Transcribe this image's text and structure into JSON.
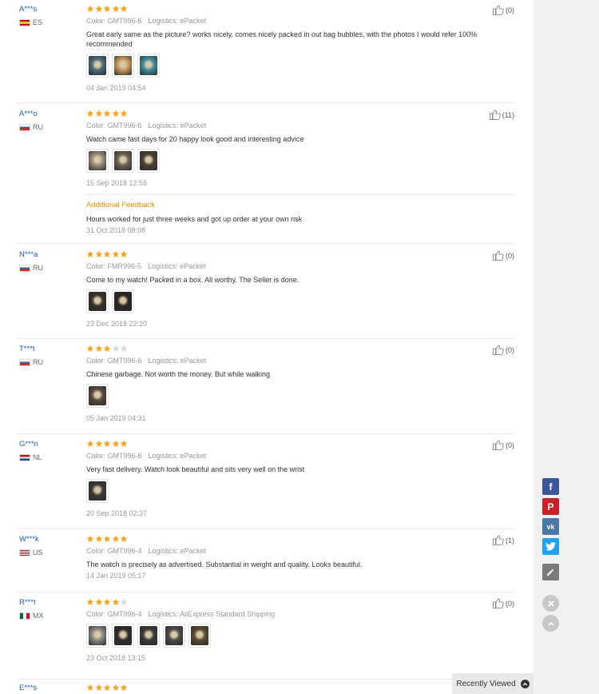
{
  "labels": {
    "color": "Color:",
    "logistics": "Logistics:",
    "additional_feedback": "Additional Feedback",
    "recently_viewed": "Recently Viewed"
  },
  "colors": {
    "star_on": "#f5a623",
    "star_off": "#d9d9d9",
    "username": "#1a5fb4",
    "accent": "#f08c00",
    "facebook": "#3b5998",
    "pinterest": "#cb2027",
    "vk": "#4a76a8",
    "twitter": "#1da1f2",
    "edit": "#7a7a7a"
  },
  "reviews": [
    {
      "user": "A***s",
      "country": "ES",
      "rating": 5,
      "color": "GMT996-6",
      "logistics": "ePacket",
      "text": "Great early same as the picture? works nicely, comes nicely packed in out bag bubbles, with the photos I would refer 100% recommended",
      "photos": 3,
      "date": "04 Jan 2019 04:54",
      "helpful": "(0)"
    },
    {
      "user": "A***o",
      "country": "RU",
      "rating": 5,
      "color": "GMT996-6",
      "logistics": "ePacket",
      "text": "Watch came fast days for 20 happy look good and interesting advice",
      "photos": 3,
      "date": "15 Sep 2018 12:55",
      "helpful": "(11)",
      "additional": {
        "text": "Hours worked for just three weeks and got up order at your own risk",
        "date": "31 Oct 2018 08:08"
      }
    },
    {
      "user": "N***a",
      "country": "RU",
      "rating": 5,
      "color": "FMR996-5",
      "logistics": "ePacket",
      "text": "Come to my watch! Packed in a box. All worthy. The Seller is done.",
      "photos": 2,
      "date": "23 Dec 2018 22:20",
      "helpful": "(0)"
    },
    {
      "user": "T***t",
      "country": "RU",
      "rating": 3,
      "color": "GMT996-6",
      "logistics": "ePacket",
      "text": "Chinese garbage. Not worth the money. But while walking",
      "photos": 1,
      "date": "05 Jan 2019 04:31",
      "helpful": "(0)"
    },
    {
      "user": "G***n",
      "country": "NL",
      "rating": 5,
      "color": "GMT996-6",
      "logistics": "ePacket",
      "text": "Very fast delivery. Watch look beautiful and sits very well on the wrist",
      "photos": 1,
      "date": "20 Sep 2018 02:37",
      "helpful": "(0)"
    },
    {
      "user": "W***k",
      "country": "US",
      "rating": 5,
      "color": "GMT996-4",
      "logistics": "ePacket",
      "text": "The watch is precisely as advertised. Substantial in weight and quality. Looks beautiful.",
      "photos": 0,
      "date": "14 Jan 2019 05:17",
      "helpful": "(1)"
    },
    {
      "user": "R***t",
      "country": "MX",
      "rating": 4,
      "color": "GMT996-4",
      "logistics": "AliExpress Standard Shipping",
      "text": "",
      "photos": 5,
      "date": "23 Oct 2018 13:15",
      "helpful": "(0)"
    },
    {
      "user": "E***s",
      "country": "",
      "rating": 5,
      "color": "",
      "logistics": "",
      "text": "",
      "photos": 0,
      "date": "",
      "helpful": ""
    }
  ],
  "share_icons": [
    "facebook-icon",
    "pinterest-icon",
    "vk-icon",
    "twitter-icon",
    "edit-icon"
  ]
}
